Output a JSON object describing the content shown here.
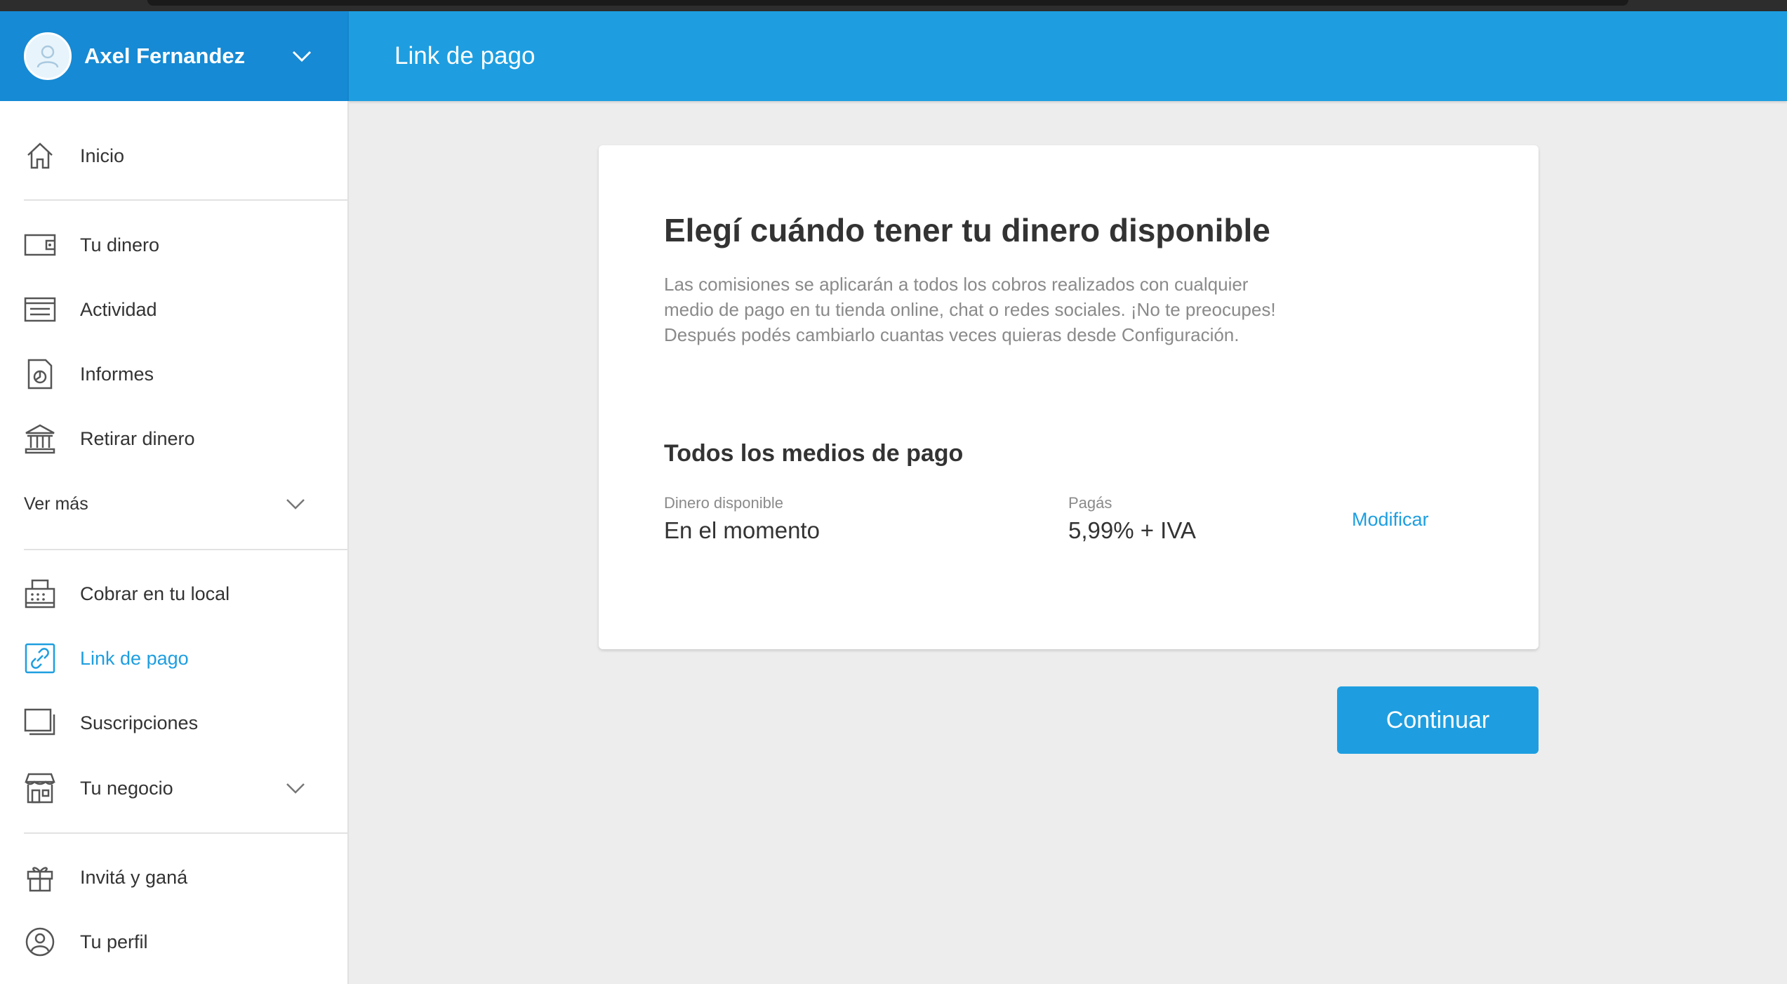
{
  "user": {
    "name": "Axel Fernandez",
    "avatar_icon": "user-avatar-icon"
  },
  "header": {
    "title": "Link de pago"
  },
  "sidebar": {
    "home": {
      "label": "Inicio",
      "icon": "home-icon"
    },
    "group1": [
      {
        "label": "Tu dinero",
        "icon": "wallet-icon"
      },
      {
        "label": "Actividad",
        "icon": "list-icon"
      },
      {
        "label": "Informes",
        "icon": "report-icon"
      },
      {
        "label": "Retirar dinero",
        "icon": "bank-icon"
      }
    ],
    "ver_mas": {
      "label": "Ver más"
    },
    "group2": [
      {
        "label": "Cobrar en tu local",
        "icon": "register-icon"
      },
      {
        "label": "Link de pago",
        "icon": "link-icon",
        "active": true
      },
      {
        "label": "Suscripciones",
        "icon": "subscriptions-icon"
      },
      {
        "label": "Tu negocio",
        "icon": "store-icon"
      }
    ],
    "group3": [
      {
        "label": "Invitá y ganá",
        "icon": "gift-icon"
      },
      {
        "label": "Tu perfil",
        "icon": "profile-icon"
      }
    ]
  },
  "card": {
    "title": "Elegí cuándo tener tu dinero disponible",
    "description": "Las comisiones se aplicarán a todos los cobros realizados con cualquier medio de pago en tu tienda online, chat o redes sociales. ¡No te preocupes! Después podés cambiarlo cuantas veces quieras desde Configuración.",
    "subtitle": "Todos los medios de pago",
    "availability_label": "Dinero disponible",
    "availability_value": "En el momento",
    "fee_label": "Pagás",
    "fee_value": "5,99% + IVA",
    "modify_label": "Modificar"
  },
  "continue_label": "Continuar",
  "colors": {
    "primary": "#1e9ee0",
    "header_left": "#168ad4",
    "background": "#ededed",
    "text": "#333333",
    "muted": "#8a8a8a"
  }
}
